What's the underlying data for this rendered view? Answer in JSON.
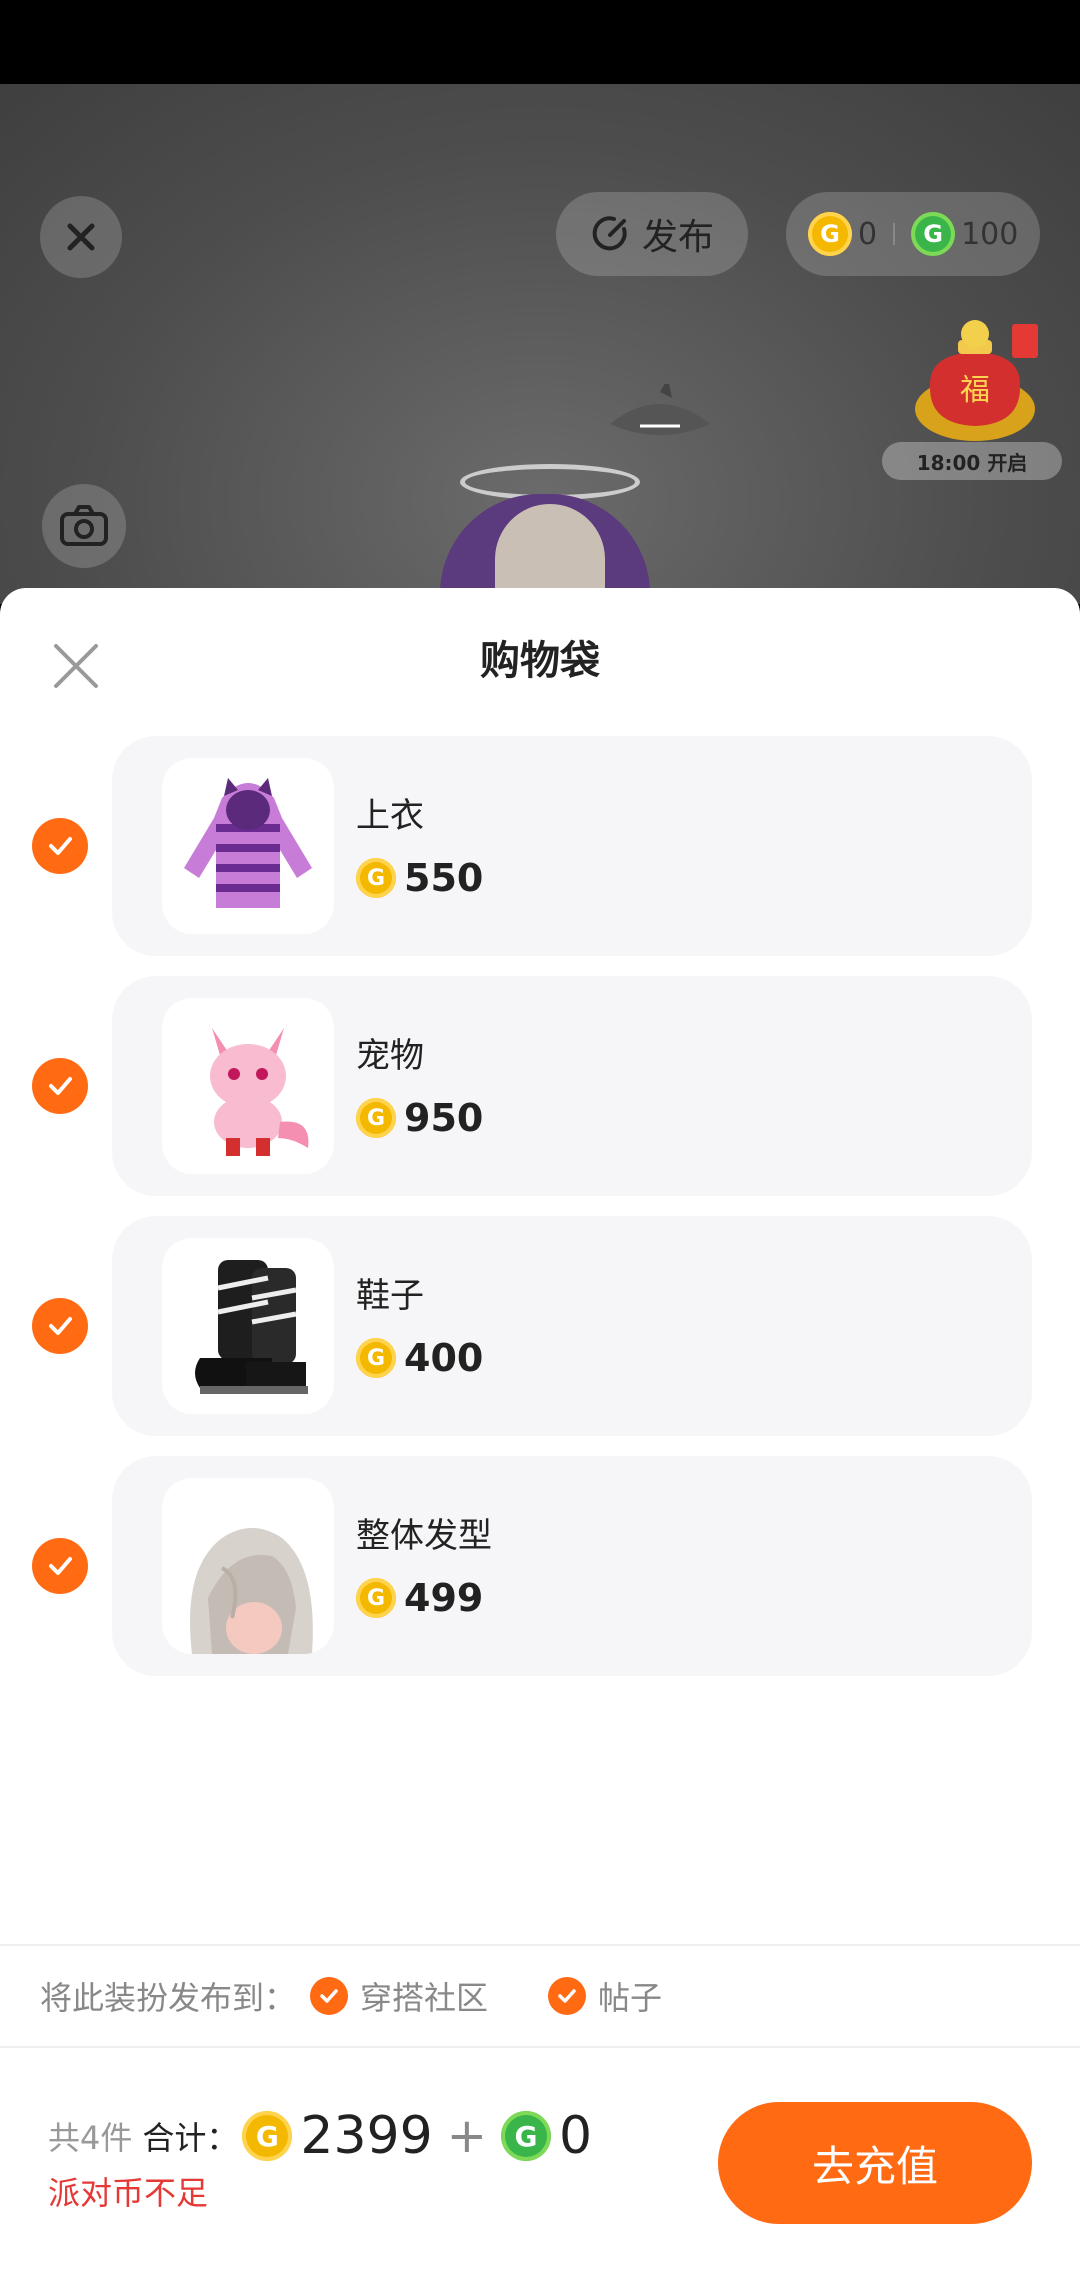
{
  "top_bar": {
    "publish_label": "发布",
    "gold_balance": "0",
    "green_balance": "100",
    "event_time_label": "18:00 开启",
    "lucky_char": "福"
  },
  "sheet": {
    "title": "购物袋",
    "items": [
      {
        "name": "上衣",
        "price": "550"
      },
      {
        "name": "宠物",
        "price": "950"
      },
      {
        "name": "鞋子",
        "price": "400"
      },
      {
        "name": "整体发型",
        "price": "499"
      }
    ],
    "publish_to_label": "将此装扮发布到：",
    "publish_targets": [
      "穿搭社区",
      "帖子"
    ]
  },
  "footer": {
    "count_label": "共4件",
    "total_label": "合计：",
    "gold_total": "2399",
    "plus": "+",
    "green_total": "0",
    "warning": "派对币不足",
    "cta_label": "去充值"
  },
  "colors": {
    "accent": "#FF6A13",
    "gold_coin": "#F5B800",
    "green_coin": "#39B54A",
    "warning": "#E53935"
  }
}
